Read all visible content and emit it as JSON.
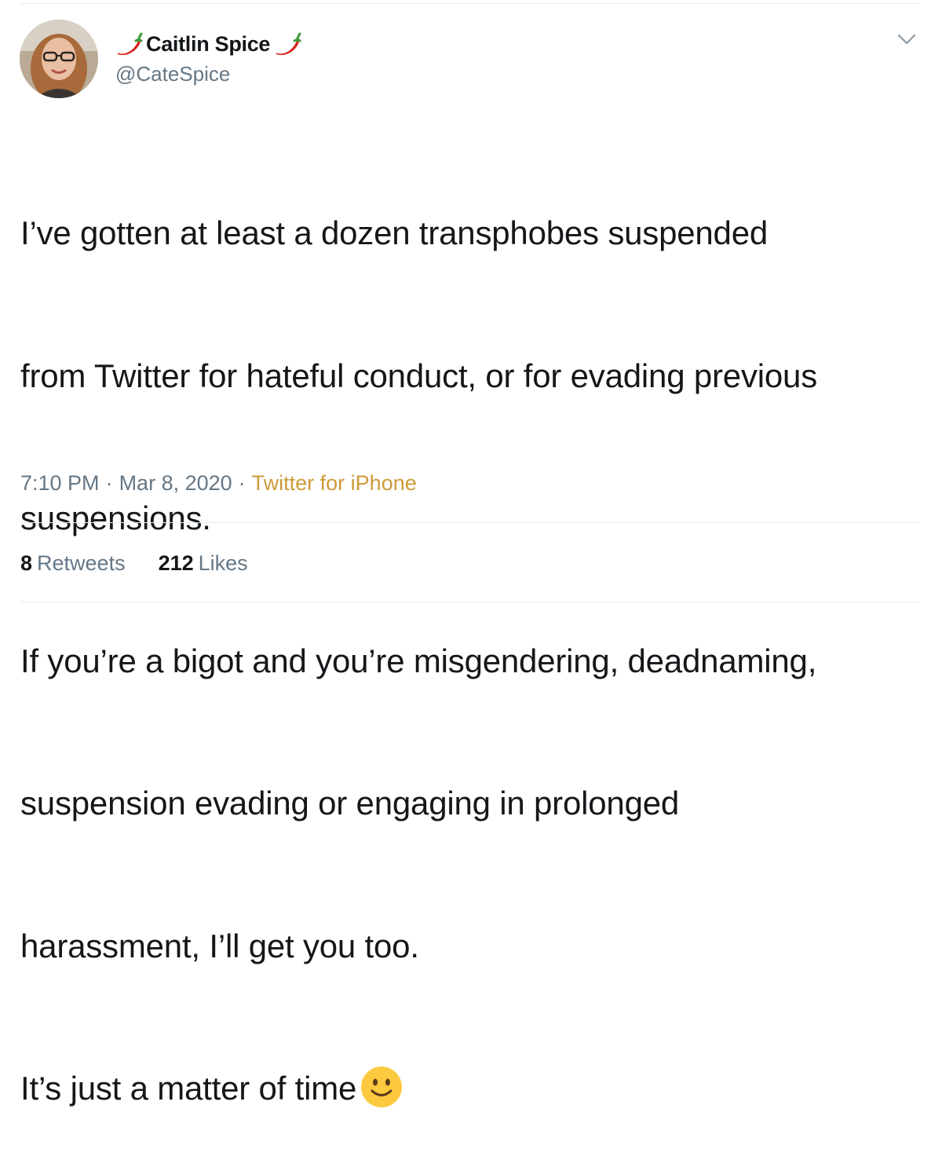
{
  "tweet": {
    "display_name": "Caitlin Spice",
    "handle": "@CateSpice",
    "text_lines": [
      "I’ve gotten at least a dozen transphobes suspended",
      "from Twitter for hateful conduct, or for evading previous",
      "suspensions.",
      "If you’re a bigot and you’re misgendering, deadnaming,",
      "suspension evading or engaging in prolonged",
      "harassment, I’ll get you too.",
      "It’s just a matter of time"
    ],
    "time": "7:10 PM",
    "separator": "·",
    "date": "Mar 8, 2020",
    "source": "Twitter for iPhone",
    "retweets_count": "8",
    "retweets_label": "Retweets",
    "likes_count": "212",
    "likes_label": "Likes"
  },
  "icons": {
    "name_prefix": "hot-pepper-icon",
    "name_suffix": "hot-pepper-icon",
    "menu": "chevron-down-icon",
    "text_end": "slightly-smiling-face-icon"
  },
  "colors": {
    "text": "#14171a",
    "secondary": "#657786",
    "source_link": "#ce9a3a",
    "divider": "#e6ecf0"
  }
}
